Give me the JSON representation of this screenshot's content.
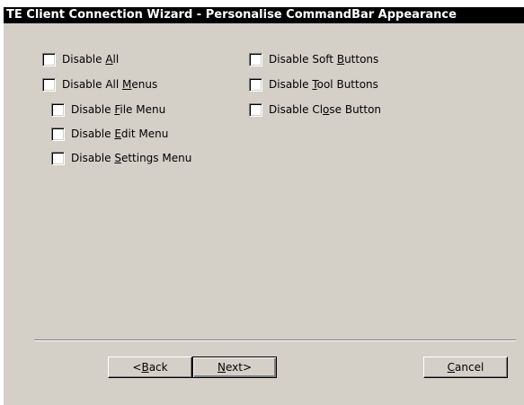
{
  "window": {
    "title": "TE Client Connection Wizard - Personalise CommandBar Appearance"
  },
  "options_left": [
    {
      "pre": "Disable ",
      "key": "A",
      "post": "ll",
      "checked": false
    },
    {
      "pre": "Disable All ",
      "key": "M",
      "post": "enus",
      "checked": false
    },
    {
      "pre": "Disable ",
      "key": "F",
      "post": "ile Menu",
      "checked": false
    },
    {
      "pre": "Disable ",
      "key": "E",
      "post": "dit Menu",
      "checked": false
    },
    {
      "pre": "Disable ",
      "key": "S",
      "post": "ettings Menu",
      "checked": false
    }
  ],
  "options_right": [
    {
      "pre": "Disable Soft ",
      "key": "B",
      "post": "uttons",
      "checked": false
    },
    {
      "pre": "Disable ",
      "key": "T",
      "post": "ool Buttons",
      "checked": false
    },
    {
      "pre": "Disable Cl",
      "key": "o",
      "post": "se Button",
      "checked": false
    }
  ],
  "buttons": {
    "back": {
      "pre": "<",
      "key": "B",
      "post": "ack"
    },
    "next": {
      "pre": "",
      "key": "N",
      "post": "ext>"
    },
    "cancel": {
      "pre": "",
      "key": "C",
      "post": "ancel"
    }
  }
}
